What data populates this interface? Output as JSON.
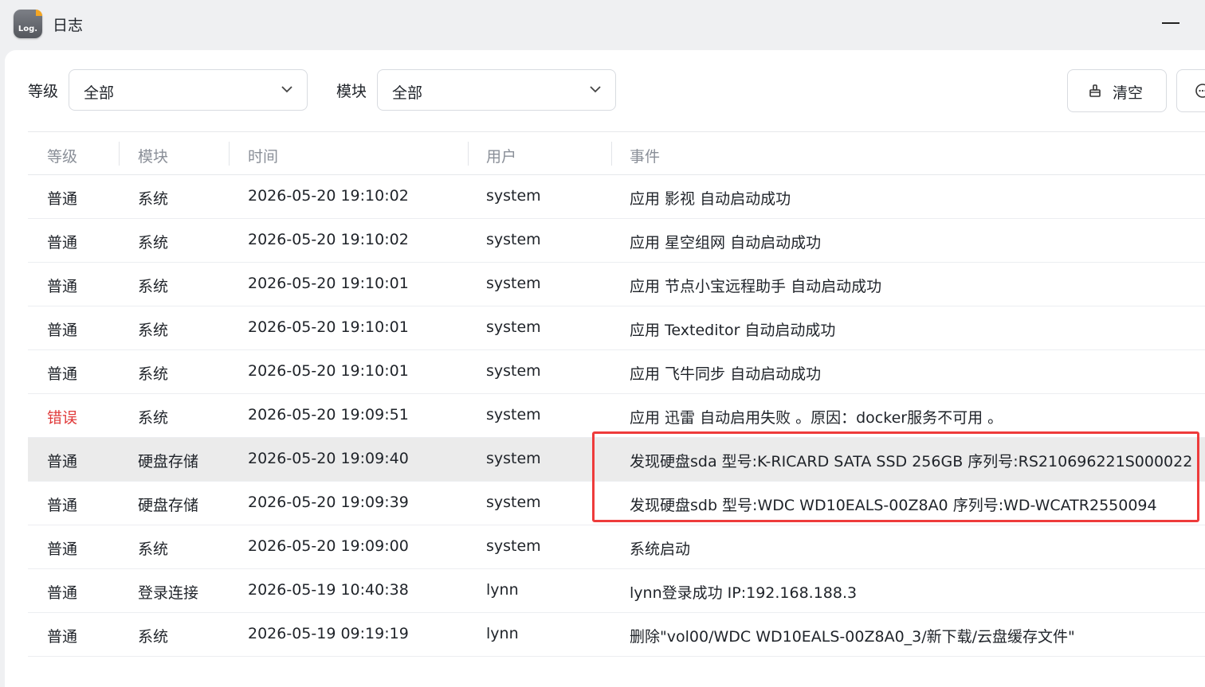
{
  "window": {
    "title": "日志",
    "icon_text": "Log."
  },
  "filters": {
    "level_label": "等级",
    "level_value": "全部",
    "module_label": "模块",
    "module_value": "全部"
  },
  "toolbar": {
    "clear_label": "清空"
  },
  "table": {
    "headers": [
      "等级",
      "模块",
      "时间",
      "用户",
      "事件"
    ],
    "rows": [
      {
        "level": "普通",
        "module": "系统",
        "time": "2026-05-20 19:10:02",
        "user": "system",
        "event": "应用 影视 自动启动成功"
      },
      {
        "level": "普通",
        "module": "系统",
        "time": "2026-05-20 19:10:02",
        "user": "system",
        "event": "应用 星空组网 自动启动成功"
      },
      {
        "level": "普通",
        "module": "系统",
        "time": "2026-05-20 19:10:01",
        "user": "system",
        "event": "应用 节点小宝远程助手 自动启动成功"
      },
      {
        "level": "普通",
        "module": "系统",
        "time": "2026-05-20 19:10:01",
        "user": "system",
        "event": "应用 Texteditor 自动启动成功"
      },
      {
        "level": "普通",
        "module": "系统",
        "time": "2026-05-20 19:10:01",
        "user": "system",
        "event": "应用 飞牛同步 自动启动成功"
      },
      {
        "level": "错误",
        "module": "系统",
        "time": "2026-05-20 19:09:51",
        "user": "system",
        "event": "应用 迅雷 自动启用失败 。原因：docker服务不可用 。"
      },
      {
        "level": "普通",
        "module": "硬盘存储",
        "time": "2026-05-20 19:09:40",
        "user": "system",
        "event": "发现硬盘sda 型号:K-RICARD SATA SSD 256GB 序列号:RS21069622​1S000022"
      },
      {
        "level": "普通",
        "module": "硬盘存储",
        "time": "2026-05-20 19:09:39",
        "user": "system",
        "event": "发现硬盘sdb 型号:WDC WD10EALS-00Z8A0 序列号:WD-WCATR2550094"
      },
      {
        "level": "普通",
        "module": "系统",
        "time": "2026-05-20 19:09:00",
        "user": "system",
        "event": "系统启动"
      },
      {
        "level": "普通",
        "module": "登录连接",
        "time": "2026-05-19 10:40:38",
        "user": "lynn",
        "event": "lynn登录成功 IP:192.168.188.3"
      },
      {
        "level": "普通",
        "module": "系统",
        "time": "2026-05-19 09:19:19",
        "user": "lynn",
        "event": "删除\"vol00/WDC WD10EALS-00Z8A0_3/新下载/云盘缓存文件\""
      }
    ]
  },
  "colors": {
    "error": "#e03a3a",
    "highlight_box": "#ee3b3b",
    "selected_row": "#ebebeb"
  }
}
